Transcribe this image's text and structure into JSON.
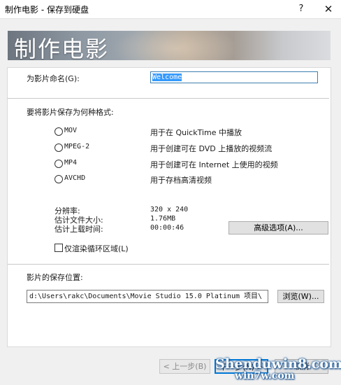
{
  "window": {
    "title": "制作电影 - 保存到硬盘",
    "help_glyph": "?",
    "close_glyph": "✕"
  },
  "banner": {
    "heading": "制作电影"
  },
  "name": {
    "label": "为影片命名(G):",
    "value": "Welcome"
  },
  "format": {
    "prompt": "要将影片保存为何种格式:",
    "options": [
      {
        "label": "MOV",
        "desc": "用于在 QuickTime 中播放"
      },
      {
        "label": "MPEG-2",
        "desc": "用于创建可在 DVD 上播放的视频流"
      },
      {
        "label": "MP4",
        "desc": "用于创建可在 Internet 上使用的视频"
      },
      {
        "label": "AVCHD",
        "desc": "用于存档高清视频"
      }
    ]
  },
  "info": {
    "resolution_label": "分辨率:",
    "resolution_value": "320 x 240",
    "size_label": "估计文件大小:",
    "size_value": "1.76MB",
    "upload_label": "估计上载时间:",
    "upload_value": "00:00:46",
    "advanced_button": "高级选项(A)..."
  },
  "loop_option": {
    "label": "仅渲染循环区域(L)"
  },
  "location": {
    "label": "影片的保存位置:",
    "path": "d:\\Users\\rakc\\Documents\\Movie Studio 15.0 Platinum 项目\\",
    "browse_button": "浏览(W)..."
  },
  "footer": {
    "back_button": "< 上一步(B)",
    "next_button": "下一步(N) >",
    "cancel_button": "取消"
  },
  "watermark": {
    "line1": "Shenduwin8.com",
    "line2": "win7w.com"
  }
}
